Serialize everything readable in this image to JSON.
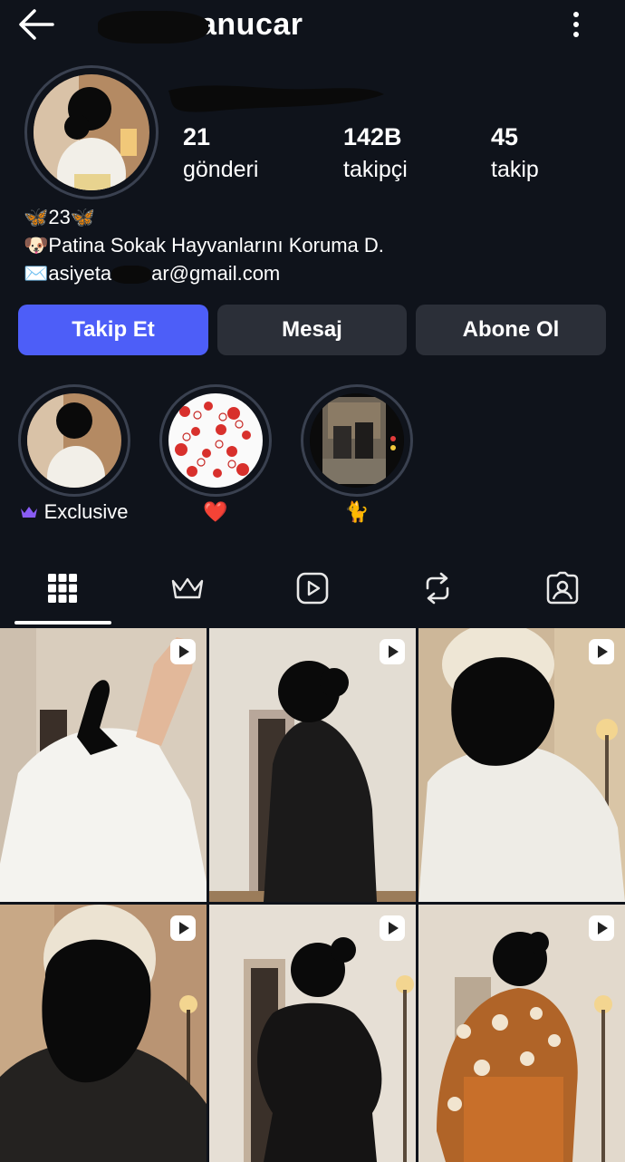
{
  "header": {
    "title": "anucar",
    "back_icon": "arrow-left-icon",
    "menu_icon": "more-vertical-icon"
  },
  "profile": {
    "stats": [
      {
        "value": "21",
        "label": "gönderi"
      },
      {
        "value": "142B",
        "label": "takipçi"
      },
      {
        "value": "45",
        "label": "takip"
      }
    ],
    "bio": {
      "line1": "🦋23🦋",
      "line2": "🐶Patina Sokak Hayvanlarını Koruma D.",
      "line3_prefix": "✉️asiyeta",
      "line3_suffix": "ar@gmail.com"
    }
  },
  "actions": {
    "follow": "Takip Et",
    "message": "Mesaj",
    "subscribe": "Abone Ol"
  },
  "highlights": [
    {
      "label": "Exclusive",
      "icon": "crown-icon"
    },
    {
      "label": "❤️"
    },
    {
      "label": "🐈"
    }
  ],
  "tabs": [
    "grid-icon",
    "crown-icon",
    "reels-icon",
    "repost-icon",
    "tagged-icon"
  ],
  "colors": {
    "background": "#0f131b",
    "primary_button": "#4d5ef8",
    "secondary_button": "#2b2f38",
    "exclusive_crown": "#8a5cf6"
  }
}
